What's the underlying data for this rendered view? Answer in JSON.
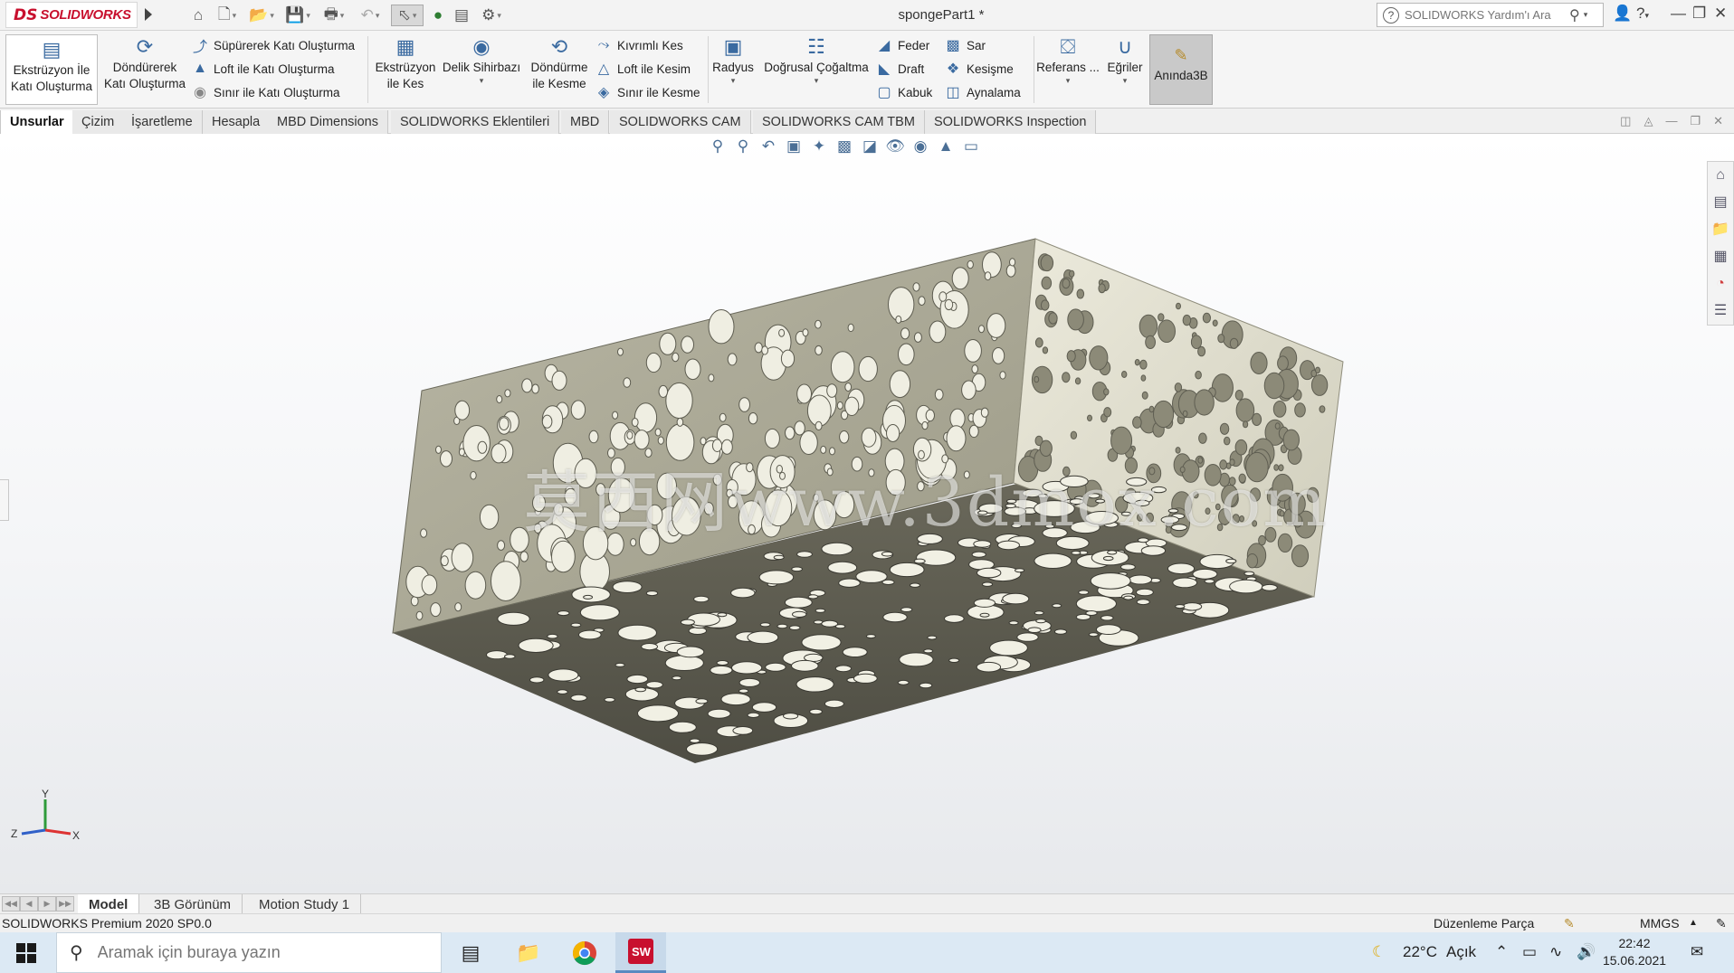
{
  "app": {
    "logo_prefix": "DS",
    "logo_text": "SOLIDWORKS",
    "document_title": "spongePart1 *"
  },
  "help_search": {
    "placeholder": "SOLIDWORKS Yardım'ı Ara"
  },
  "commands": {
    "extrude_boss": "Ekstrüzyon İle Katı Oluşturma",
    "revolve_boss": "Döndürerek Katı Oluşturma",
    "swept_boss": "Süpürerek Katı Oluşturma",
    "loft_boss": "Loft ile Katı Oluşturma",
    "boundary_boss": "Sınır ile Katı Oluşturma",
    "extrude_cut": "Ekstrüzyon ile Kes",
    "hole_wizard": "Delik Sihirbazı",
    "revolve_cut": "Döndürme ile Kesme",
    "swept_cut": "Kıvrımlı Kes",
    "loft_cut": "Loft ile Kesim",
    "boundary_cut": "Sınır ile Kesme",
    "fillet": "Radyus",
    "linear_pattern": "Doğrusal Çoğaltma",
    "rib": "Feder",
    "wrap": "Sar",
    "draft": "Draft",
    "intersect": "Kesişme",
    "shell": "Kabuk",
    "mirror": "Aynalama",
    "reference": "Referans ...",
    "curves": "Eğriler",
    "instant3d": "Anında3B"
  },
  "tabs": [
    "Unsurlar",
    "Çizim",
    "İşaretleme",
    "Hesapla",
    "MBD Dimensions",
    "SOLIDWORKS Eklentileri",
    "MBD",
    "SOLIDWORKS CAM",
    "SOLIDWORKS CAM TBM",
    "SOLIDWORKS Inspection"
  ],
  "watermark": "莫西网www.3dmox.com",
  "triad": {
    "x": "X",
    "y": "Y",
    "z": "Z"
  },
  "bottom_tabs": [
    "Model",
    "3B Görünüm",
    "Motion Study 1"
  ],
  "status": {
    "product": "SOLIDWORKS Premium 2020 SP0.0",
    "mode": "Düzenleme Parça",
    "units": "MMGS"
  },
  "taskbar": {
    "search_placeholder": "Aramak için buraya yazın",
    "temperature": "22°C",
    "weather": "Açık",
    "time": "22:42",
    "date": "15.06.2021"
  },
  "colors": {
    "brand_red": "#c8102e",
    "accent_blue": "#3a6aa0",
    "taskbar": "#dce9f4"
  }
}
